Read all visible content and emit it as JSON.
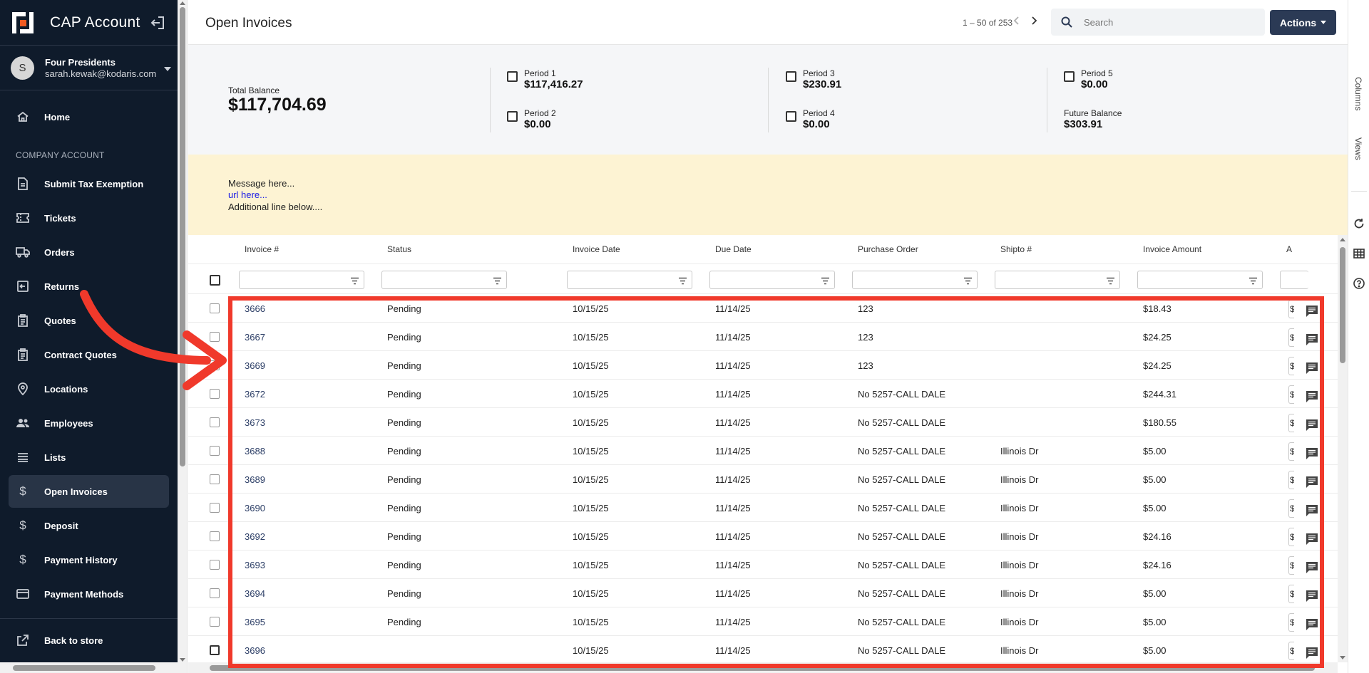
{
  "app": {
    "title": "CAP Account"
  },
  "account": {
    "avatar_initial": "S",
    "name": "Four Presidents",
    "email": "sarah.kewak@kodaris.com"
  },
  "sidebar": {
    "section_label": "COMPANY ACCOUNT",
    "items": [
      {
        "label": "Home",
        "icon": "home-icon"
      },
      {
        "label": "Submit Tax Exemption",
        "icon": "document-icon"
      },
      {
        "label": "Tickets",
        "icon": "ticket-icon"
      },
      {
        "label": "Orders",
        "icon": "truck-icon"
      },
      {
        "label": "Returns",
        "icon": "return-icon"
      },
      {
        "label": "Quotes",
        "icon": "clipboard-icon"
      },
      {
        "label": "Contract Quotes",
        "icon": "clipboard-icon"
      },
      {
        "label": "Locations",
        "icon": "location-pin-icon"
      },
      {
        "label": "Employees",
        "icon": "people-icon"
      },
      {
        "label": "Lists",
        "icon": "list-icon"
      },
      {
        "label": "Open Invoices",
        "icon": "dollar-icon",
        "active": true
      },
      {
        "label": "Deposit",
        "icon": "dollar-icon"
      },
      {
        "label": "Payment History",
        "icon": "dollar-icon"
      },
      {
        "label": "Payment Methods",
        "icon": "credit-card-icon"
      }
    ],
    "back_label": "Back to store"
  },
  "header": {
    "page_title": "Open Invoices",
    "pager_text": "1 – 50 of 253",
    "search_placeholder": "Search",
    "actions_label": "Actions"
  },
  "right_rail": {
    "columns_label": "Columns",
    "views_label": "Views"
  },
  "summary": {
    "total_label": "Total Balance",
    "total_value": "$117,704.69",
    "periods": [
      {
        "label": "Period 1",
        "value": "$117,416.27"
      },
      {
        "label": "Period 2",
        "value": "$0.00"
      },
      {
        "label": "Period 3",
        "value": "$230.91"
      },
      {
        "label": "Period 4",
        "value": "$0.00"
      },
      {
        "label": "Period 5",
        "value": "$0.00"
      }
    ],
    "future_label": "Future Balance",
    "future_value": "$303.91"
  },
  "message": {
    "line1": "Message here...",
    "link": "url here...",
    "line3": "Additional line below...."
  },
  "table": {
    "columns": [
      "Invoice #",
      "Status",
      "Invoice Date",
      "Due Date",
      "Purchase Order",
      "Shipto #",
      "Invoice Amount",
      "A"
    ],
    "cutoff_cell": "$",
    "rows": [
      {
        "invoice": "3666",
        "status": "Pending",
        "invoice_date": "10/15/25",
        "due_date": "11/14/25",
        "po": "123",
        "shipto": "",
        "amount": "$18.43"
      },
      {
        "invoice": "3667",
        "status": "Pending",
        "invoice_date": "10/15/25",
        "due_date": "11/14/25",
        "po": "123",
        "shipto": "",
        "amount": "$24.25"
      },
      {
        "invoice": "3669",
        "status": "Pending",
        "invoice_date": "10/15/25",
        "due_date": "11/14/25",
        "po": "123",
        "shipto": "",
        "amount": "$24.25"
      },
      {
        "invoice": "3672",
        "status": "Pending",
        "invoice_date": "10/15/25",
        "due_date": "11/14/25",
        "po": "No 5257-CALL DALE",
        "shipto": "",
        "amount": "$244.31"
      },
      {
        "invoice": "3673",
        "status": "Pending",
        "invoice_date": "10/15/25",
        "due_date": "11/14/25",
        "po": "No 5257-CALL DALE",
        "shipto": "",
        "amount": "$180.55"
      },
      {
        "invoice": "3688",
        "status": "Pending",
        "invoice_date": "10/15/25",
        "due_date": "11/14/25",
        "po": "No 5257-CALL DALE",
        "shipto": "Illinois Dr",
        "amount": "$5.00"
      },
      {
        "invoice": "3689",
        "status": "Pending",
        "invoice_date": "10/15/25",
        "due_date": "11/14/25",
        "po": "No 5257-CALL DALE",
        "shipto": "Illinois Dr",
        "amount": "$5.00"
      },
      {
        "invoice": "3690",
        "status": "Pending",
        "invoice_date": "10/15/25",
        "due_date": "11/14/25",
        "po": "No 5257-CALL DALE",
        "shipto": "Illinois Dr",
        "amount": "$5.00"
      },
      {
        "invoice": "3692",
        "status": "Pending",
        "invoice_date": "10/15/25",
        "due_date": "11/14/25",
        "po": "No 5257-CALL DALE",
        "shipto": "Illinois Dr",
        "amount": "$24.16"
      },
      {
        "invoice": "3693",
        "status": "Pending",
        "invoice_date": "10/15/25",
        "due_date": "11/14/25",
        "po": "No 5257-CALL DALE",
        "shipto": "Illinois Dr",
        "amount": "$24.16"
      },
      {
        "invoice": "3694",
        "status": "Pending",
        "invoice_date": "10/15/25",
        "due_date": "11/14/25",
        "po": "No 5257-CALL DALE",
        "shipto": "Illinois Dr",
        "amount": "$5.00"
      },
      {
        "invoice": "3695",
        "status": "Pending",
        "invoice_date": "10/15/25",
        "due_date": "11/14/25",
        "po": "No 5257-CALL DALE",
        "shipto": "Illinois Dr",
        "amount": "$5.00"
      },
      {
        "invoice": "3696",
        "status": "",
        "invoice_date": "10/15/25",
        "due_date": "11/14/25",
        "po": "No 5257-CALL DALE",
        "shipto": "Illinois Dr",
        "amount": "$5.00"
      }
    ]
  },
  "annotation": {
    "color": "#f0392b"
  }
}
